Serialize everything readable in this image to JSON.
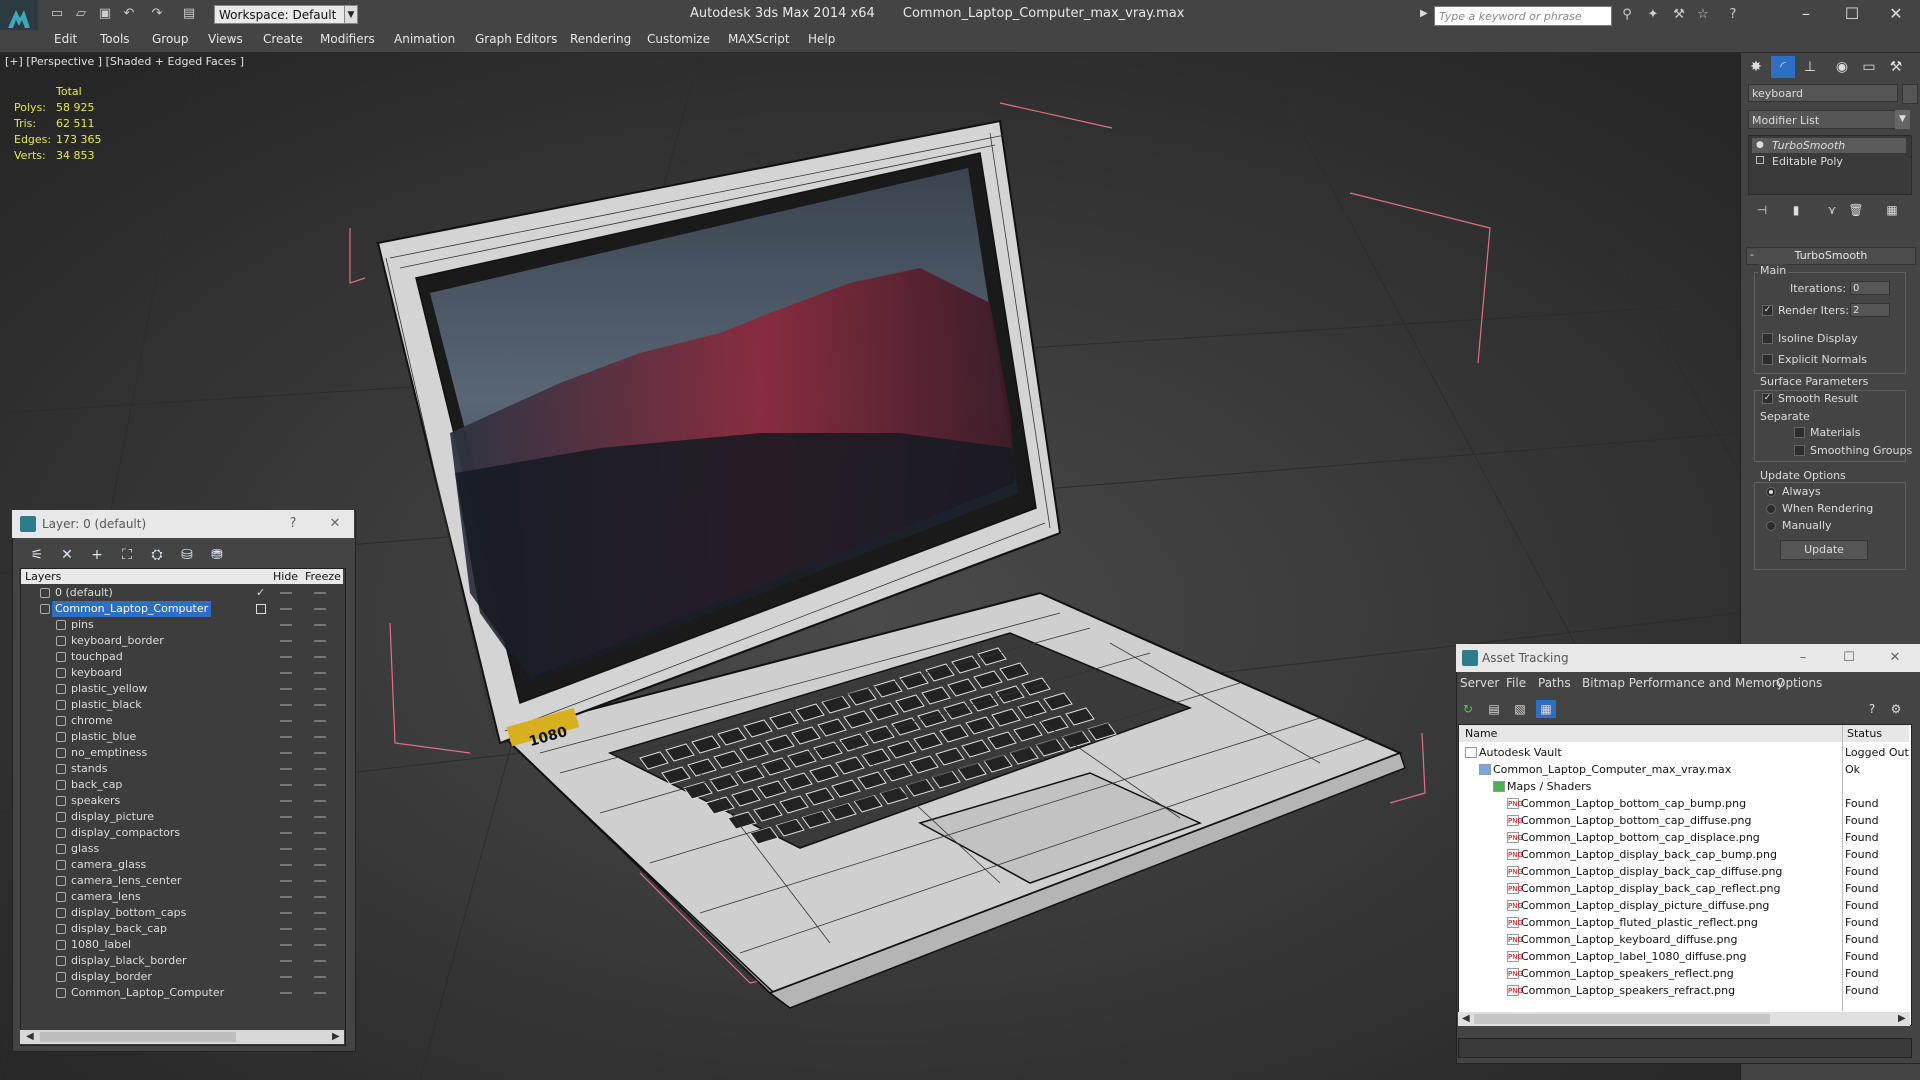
{
  "title_bar": {
    "workspace": "Workspace: Default",
    "app_title": "Autodesk 3ds Max  2014 x64",
    "file_name": "Common_Laptop_Computer_max_vray.max",
    "search_placeholder": "Type a keyword or phrase"
  },
  "menu": [
    "Edit",
    "Tools",
    "Group",
    "Views",
    "Create",
    "Modifiers",
    "Animation",
    "Graph Editors",
    "Rendering",
    "Customize",
    "MAXScript",
    "Help"
  ],
  "viewport": {
    "label": "[+] [Perspective ] [Shaded + Edged Faces ]",
    "stats": {
      "header": "Total",
      "polys_label": "Polys:",
      "polys": "58 925",
      "tris_label": "Tris:",
      "tris": "62 511",
      "edges_label": "Edges:",
      "edges": "173 365",
      "verts_label": "Verts:",
      "verts": "34 853"
    },
    "laptop_label": "1080"
  },
  "command_panel": {
    "object_name": "keyboard",
    "modifier_list": "Modifier List",
    "stack": [
      "TurboSmooth",
      "Editable Poly"
    ],
    "rollout_title": "TurboSmooth",
    "main_group": "Main",
    "iterations_label": "Iterations:",
    "iterations": "0",
    "render_iters_label": "Render Iters:",
    "render_iters": "2",
    "isoline_label": "Isoline Display",
    "explicit_normals_label": "Explicit Normals",
    "surface_group": "Surface Parameters",
    "smooth_result_label": "Smooth Result",
    "separate_label": "Separate",
    "materials_label": "Materials",
    "smoothing_groups_label": "Smoothing Groups",
    "update_group": "Update Options",
    "always_label": "Always",
    "when_rendering_label": "When Rendering",
    "manually_label": "Manually",
    "update_button": "Update"
  },
  "layer_dialog": {
    "title": "Layer: 0 (default)",
    "col_layers": "Layers",
    "col_hide": "Hide",
    "col_freeze": "Freeze",
    "layers": [
      "0 (default)",
      "Common_Laptop_Computer",
      "pins",
      "keyboard_border",
      "touchpad",
      "keyboard",
      "plastic_yellow",
      "plastic_black",
      "chrome",
      "plastic_blue",
      "no_emptiness",
      "stands",
      "back_cap",
      "speakers",
      "display_picture",
      "display_compactors",
      "glass",
      "camera_glass",
      "camera_lens_center",
      "camera_lens",
      "display_bottom_caps",
      "display_back_cap",
      "1080_label",
      "display_black_border",
      "display_border",
      "Common_Laptop_Computer"
    ]
  },
  "asset_tracking": {
    "title": "Asset Tracking",
    "menu": [
      "Server",
      "File",
      "Paths",
      "Bitmap Performance and Memory",
      "Options"
    ],
    "col_name": "Name",
    "col_status": "Status",
    "rows": [
      {
        "name": "Autodesk Vault",
        "status": "Logged Out"
      },
      {
        "name": "Common_Laptop_Computer_max_vray.max",
        "status": "Ok"
      },
      {
        "name": "Maps / Shaders",
        "status": ""
      },
      {
        "name": "Common_Laptop_bottom_cap_bump.png",
        "status": "Found"
      },
      {
        "name": "Common_Laptop_bottom_cap_diffuse.png",
        "status": "Found"
      },
      {
        "name": "Common_Laptop_bottom_cap_displace.png",
        "status": "Found"
      },
      {
        "name": "Common_Laptop_display_back_cap_bump.png",
        "status": "Found"
      },
      {
        "name": "Common_Laptop_display_back_cap_diffuse.png",
        "status": "Found"
      },
      {
        "name": "Common_Laptop_display_back_cap_reflect.png",
        "status": "Found"
      },
      {
        "name": "Common_Laptop_display_picture_diffuse.png",
        "status": "Found"
      },
      {
        "name": "Common_Laptop_fluted_plastic_reflect.png",
        "status": "Found"
      },
      {
        "name": "Common_Laptop_keyboard_diffuse.png",
        "status": "Found"
      },
      {
        "name": "Common_Laptop_label_1080_diffuse.png",
        "status": "Found"
      },
      {
        "name": "Common_Laptop_speakers_reflect.png",
        "status": "Found"
      },
      {
        "name": "Common_Laptop_speakers_refract.png",
        "status": "Found"
      }
    ]
  },
  "colors": {
    "accent_selection": "#2e6fc4",
    "stats_text": "#e8e650",
    "bbox_lines": "#e0708a"
  }
}
